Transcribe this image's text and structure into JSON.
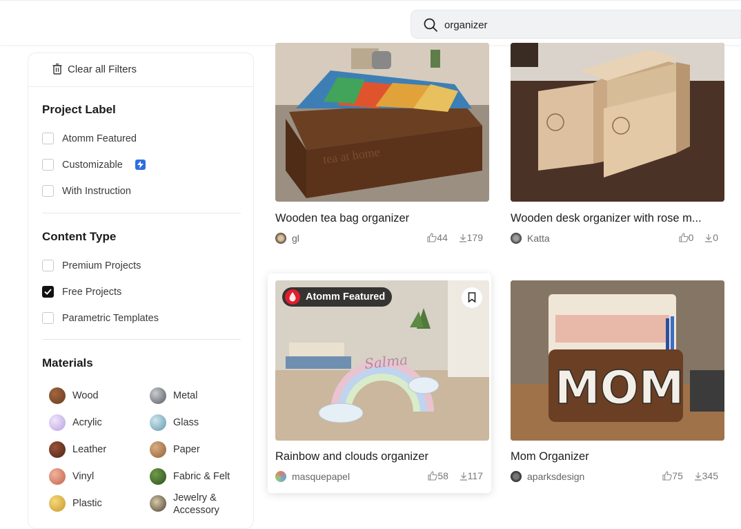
{
  "search": {
    "value": "organizer"
  },
  "sidebar": {
    "clear_label": "Clear all Filters",
    "project_label": {
      "title": "Project Label",
      "items": [
        {
          "label": "Atomm Featured",
          "checked": false
        },
        {
          "label": "Customizable",
          "checked": false,
          "badge": "lightning-badge"
        },
        {
          "label": "With Instruction",
          "checked": false
        }
      ]
    },
    "content_type": {
      "title": "Content Type",
      "items": [
        {
          "label": "Premium Projects",
          "checked": false
        },
        {
          "label": "Free Projects",
          "checked": true
        },
        {
          "label": "Parametric Templates",
          "checked": false
        }
      ]
    },
    "materials": {
      "title": "Materials",
      "items": [
        {
          "label": "Wood",
          "color": "#7a4a2e"
        },
        {
          "label": "Metal",
          "color": "#8d8f96"
        },
        {
          "label": "Acrylic",
          "color": "#cdb8ea"
        },
        {
          "label": "Glass",
          "color": "#8fb9c9"
        },
        {
          "label": "Leather",
          "color": "#6b3422"
        },
        {
          "label": "Paper",
          "color": "#b8875a"
        },
        {
          "label": "Vinyl",
          "color": "#d9866b"
        },
        {
          "label": "Fabric & Felt",
          "color": "#3f6b2c"
        },
        {
          "label": "Plastic",
          "color": "#e2b84a"
        },
        {
          "label": "Jewelry & Accessory",
          "label_line1": "Jewelry &",
          "label_line2": "Accessory",
          "color": "#7a6a52"
        }
      ]
    }
  },
  "cards": [
    {
      "title": "Wooden tea bag organizer",
      "author": "gl",
      "likes": "44",
      "downloads": "179"
    },
    {
      "title": "Wooden desk organizer with rose m...",
      "author": "Katta",
      "likes": "0",
      "downloads": "0"
    },
    {
      "title": "Rainbow and clouds organizer",
      "author": "masquepapel",
      "likes": "58",
      "downloads": "117",
      "featured_label": "Atomm Featured"
    },
    {
      "title": "Mom Organizer",
      "author": "aparksdesign",
      "likes": "75",
      "downloads": "345"
    }
  ]
}
